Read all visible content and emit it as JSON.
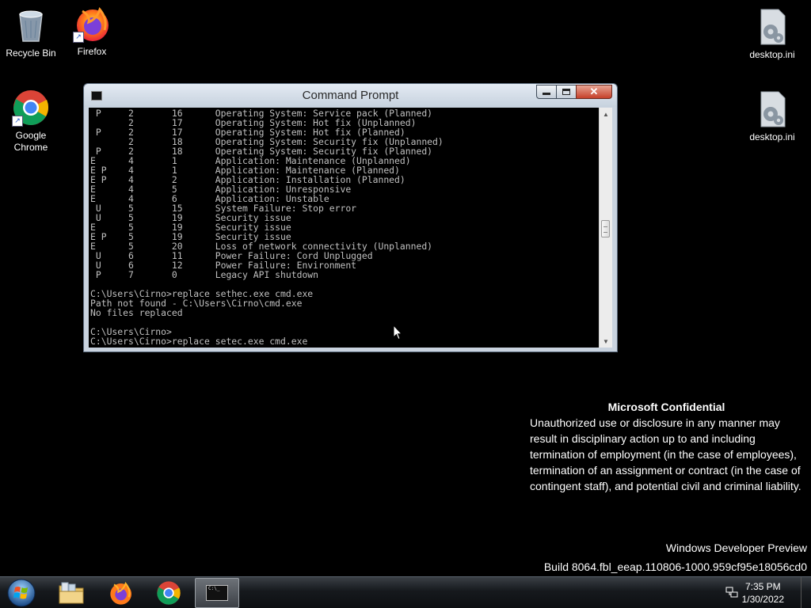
{
  "desktop": {
    "icons": [
      {
        "label": "Recycle Bin",
        "icon": "recycle-bin-icon"
      },
      {
        "label": "Firefox",
        "icon": "firefox-icon"
      },
      {
        "label": "Google Chrome",
        "icon": "chrome-icon"
      },
      {
        "label": "desktop.ini",
        "icon": "ini-file-icon"
      },
      {
        "label": "desktop.ini",
        "icon": "ini-file-icon"
      }
    ]
  },
  "cmd": {
    "title": "Command Prompt",
    "lines": [
      " P     2       16      Operating System: Service pack (Planned)",
      "       2       17      Operating System: Hot fix (Unplanned)",
      " P     2       17      Operating System: Hot fix (Planned)",
      "       2       18      Operating System: Security fix (Unplanned)",
      " P     2       18      Operating System: Security fix (Planned)",
      "E      4       1       Application: Maintenance (Unplanned)",
      "E P    4       1       Application: Maintenance (Planned)",
      "E P    4       2       Application: Installation (Planned)",
      "E      4       5       Application: Unresponsive",
      "E      4       6       Application: Unstable",
      " U     5       15      System Failure: Stop error",
      " U     5       19      Security issue",
      "E      5       19      Security issue",
      "E P    5       19      Security issue",
      "E      5       20      Loss of network connectivity (Unplanned)",
      " U     6       11      Power Failure: Cord Unplugged",
      " U     6       12      Power Failure: Environment",
      " P     7       0       Legacy API shutdown",
      "",
      "C:\\Users\\Cirno>replace sethec.exe cmd.exe",
      "Path not found - C:\\Users\\Cirno\\cmd.exe",
      "No files replaced",
      "",
      "C:\\Users\\Cirno>",
      "C:\\Users\\Cirno>replace setec.exe cmd.exe"
    ]
  },
  "watermark": {
    "heading": "Microsoft Confidential",
    "body": "Unauthorized use or disclosure in any manner may result in disciplinary action up to and including termination of employment (in the case of employees), termination of an assignment or contract (in the case of contingent staff), and potential civil and criminal liability.",
    "edition": "Windows Developer Preview",
    "build": "Build 8064.fbl_eeap.110806-1000.959cf95e18056cd0"
  },
  "taskbar": {
    "items": [
      "start-orb-icon",
      "file-explorer-icon",
      "firefox-icon",
      "chrome-icon",
      "command-prompt-icon"
    ],
    "time": "7:35 PM",
    "date": "1/30/2022"
  },
  "colors": {
    "console_bg": "#000000",
    "console_text": "#c0c0c0",
    "title_bar": "#c7d2de",
    "close_button": "#c6412a"
  }
}
